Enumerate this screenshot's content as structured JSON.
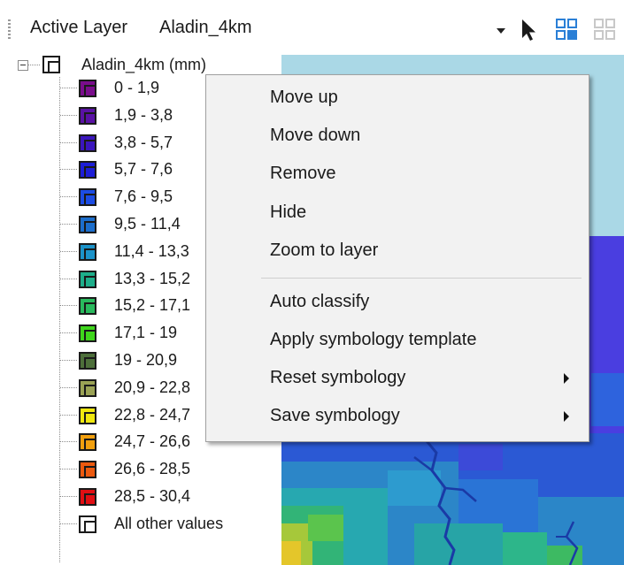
{
  "toolbar": {
    "active_layer_label": "Active Layer",
    "layer_value": "Aladin_4km",
    "tools": [
      "select-arrow-icon",
      "grid-view-icon",
      "grid-view-disabled-icon"
    ]
  },
  "tree": {
    "root_label": "Aladin_4km (mm)",
    "items": [
      {
        "label": "0 - 1,9",
        "color": "#7a0d8c"
      },
      {
        "label": "1,9 - 3,8",
        "color": "#5a12a4"
      },
      {
        "label": "3,8 - 5,7",
        "color": "#3b16bd"
      },
      {
        "label": "5,7 - 7,6",
        "color": "#1d1ed6"
      },
      {
        "label": "7,6 - 9,5",
        "color": "#1c4ce4"
      },
      {
        "label": "9,5 - 11,4",
        "color": "#1c6ecc"
      },
      {
        "label": "11,4 - 13,3",
        "color": "#1c93c9"
      },
      {
        "label": "13,3 - 15,2",
        "color": "#1eae8a"
      },
      {
        "label": "15,2 - 17,1",
        "color": "#29b95d"
      },
      {
        "label": "17,1 - 19",
        "color": "#3fd61c"
      },
      {
        "label": "19 - 20,9",
        "color": "#4d6f3a"
      },
      {
        "label": "20,9 - 22,8",
        "color": "#9aa255"
      },
      {
        "label": "22,8 - 24,7",
        "color": "#f0e80e"
      },
      {
        "label": "24,7 - 26,6",
        "color": "#f2a00e"
      },
      {
        "label": "26,6 - 28,5",
        "color": "#ec5a10"
      },
      {
        "label": "28,5 - 30,4",
        "color": "#e10f13"
      },
      {
        "label": "All other values",
        "color": "#ffffff"
      }
    ]
  },
  "menu": {
    "items": [
      {
        "label": "Move up",
        "submenu": false
      },
      {
        "label": "Move down",
        "submenu": false
      },
      {
        "label": "Remove",
        "submenu": false
      },
      {
        "label": "Hide",
        "submenu": false
      },
      {
        "label": "Zoom to layer",
        "submenu": false
      },
      {
        "label": "Auto classify",
        "submenu": false
      },
      {
        "label": "Apply symbology template",
        "submenu": false
      },
      {
        "label": "Reset symbology",
        "submenu": true
      },
      {
        "label": "Save symbology",
        "submenu": true
      }
    ]
  },
  "map": {
    "sea_color": "#aad8e6",
    "land_color": "#4a3ee0",
    "river_color": "#1a3aa6"
  }
}
